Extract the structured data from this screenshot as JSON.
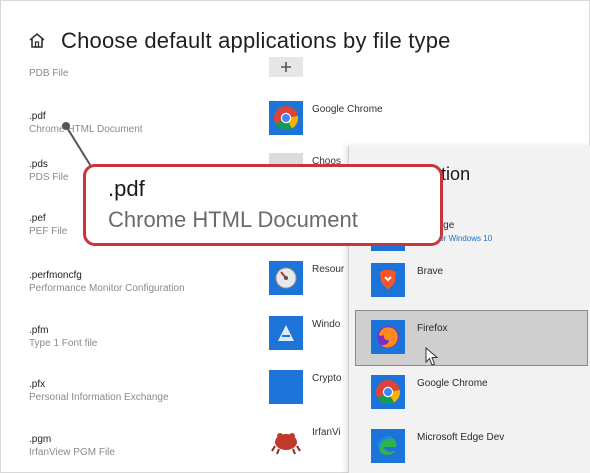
{
  "header": {
    "title": "Choose default applications by file type",
    "home_icon": "home-icon"
  },
  "file_types": [
    {
      "extension": "",
      "description": "PDB File"
    },
    {
      "extension": ".pdf",
      "description": "Chrome HTML Document"
    },
    {
      "extension": ".pds",
      "description": "PDS File"
    },
    {
      "extension": ".pef",
      "description": "PEF File"
    },
    {
      "extension": ".perfmoncfg",
      "description": "Performance Monitor Configuration"
    },
    {
      "extension": ".pfm",
      "description": "Type 1 Font file"
    },
    {
      "extension": ".pfx",
      "description": "Personal Information Exchange"
    },
    {
      "extension": ".pgm",
      "description": "IrfanView PGM File"
    }
  ],
  "default_apps": [
    {
      "label": "",
      "icon": "plus-icon"
    },
    {
      "label": "Google Chrome",
      "icon": "chrome-icon"
    },
    {
      "label": "Choos",
      "icon": "blank-icon"
    },
    {
      "label": "Resour",
      "icon": "resource-monitor-icon"
    },
    {
      "label": "Windo",
      "icon": "windows-font-icon"
    },
    {
      "label": "Crypto",
      "icon": "crypto-shell-icon"
    },
    {
      "label": "IrfanVi",
      "icon": "irfanview-icon"
    }
  ],
  "flyout": {
    "title": "n application",
    "items": [
      {
        "label": "oft Edge",
        "sublabel": "nded for Windows 10",
        "icon": "edge-icon"
      },
      {
        "label": "Brave",
        "icon": "brave-icon"
      },
      {
        "label": "Firefox",
        "icon": "firefox-icon",
        "selected": true
      },
      {
        "label": "Google Chrome",
        "icon": "chrome-icon"
      },
      {
        "label": "Microsoft Edge Dev",
        "icon": "edge-dev-icon"
      }
    ]
  },
  "callout": {
    "extension": ".pdf",
    "description": "Chrome HTML Document"
  },
  "colors": {
    "callout_border": "#c8363c",
    "flyout_bg": "#f2f2f2",
    "selected_bg": "#cfcfcf",
    "link": "#1a73c8"
  }
}
